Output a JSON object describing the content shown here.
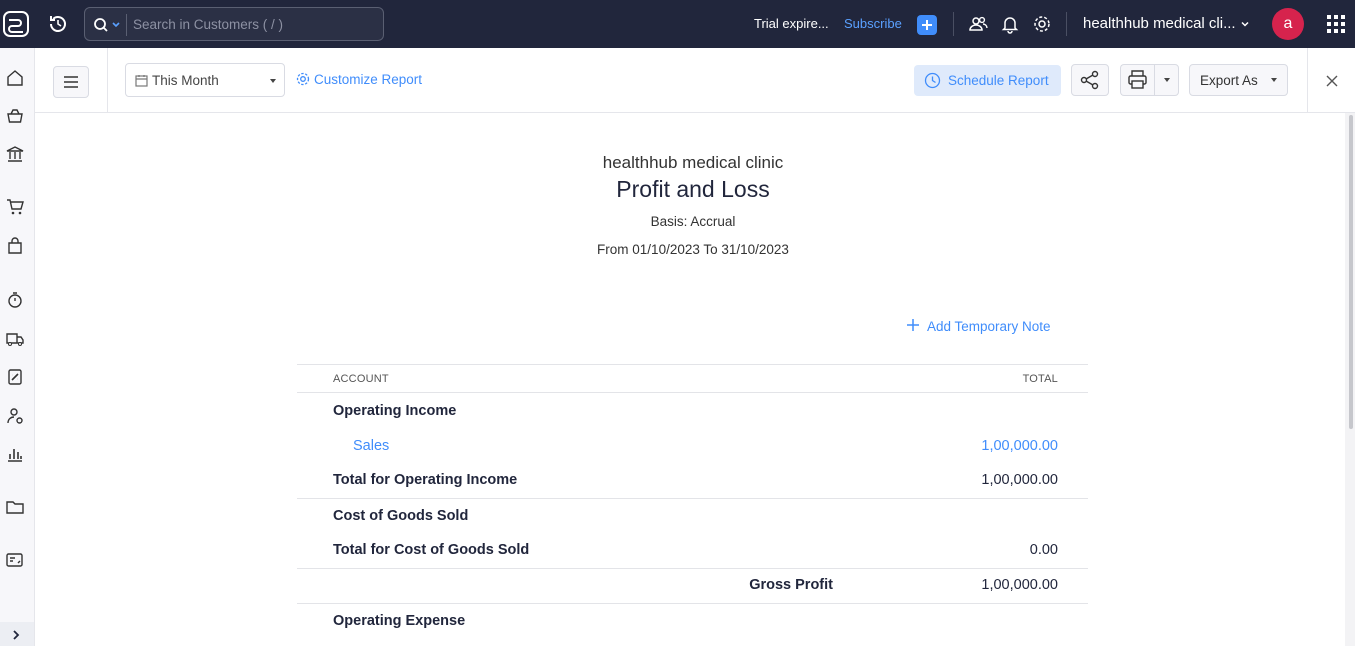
{
  "topbar": {
    "search_placeholder": "Search in Customers ( / )",
    "trial_text": "Trial expire...",
    "subscribe_label": "Subscribe",
    "org_name": "healthhub medical cli...",
    "avatar_initial": "a"
  },
  "sidebar": {
    "items": [
      "home-icon",
      "items-icon",
      "banking-icon",
      "sales-icon",
      "purchases-icon",
      "time-tracking-icon",
      "e-way-bills-icon",
      "gst-filing-icon",
      "accountant-icon",
      "reports-icon",
      "documents-icon",
      "config-icon"
    ]
  },
  "toolbar": {
    "period_label": "This Month",
    "customize_label": "Customize Report",
    "schedule_label": "Schedule Report",
    "export_label": "Export As"
  },
  "report": {
    "org_title": "healthhub medical clinic",
    "title": "Profit and Loss",
    "basis": "Basis: Accrual",
    "date_range": "From 01/10/2023 To 31/10/2023",
    "add_note_label": "Add Temporary Note",
    "columns": {
      "account": "ACCOUNT",
      "total": "TOTAL"
    },
    "rows": {
      "operating_income": "Operating Income",
      "sales_label": "Sales",
      "sales_total": "1,00,000.00",
      "total_operating_income_label": "Total for Operating Income",
      "total_operating_income": "1,00,000.00",
      "cogs": "Cost of Goods Sold",
      "total_cogs_label": "Total for Cost of Goods Sold",
      "total_cogs": "0.00",
      "gross_profit_label": "Gross Profit",
      "gross_profit": "1,00,000.00",
      "operating_expense": "Operating Expense"
    }
  },
  "colors": {
    "topbar_bg": "#21263c",
    "accent": "#408dfb",
    "avatar_bg": "#d6234d"
  }
}
